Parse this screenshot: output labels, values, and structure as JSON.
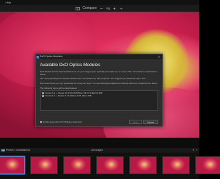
{
  "menubar": {
    "items": [
      "",
      "Help"
    ]
  },
  "toolbar": {
    "compare_label": "Compare",
    "zoom_value": "Fit"
  },
  "viewer": {
    "tag": ""
  },
  "dialog": {
    "window_title": "DxO Optics Modules",
    "heading": "Available DxO Optics Modules",
    "para1": "DxO PhotoLab has detected that some of your images were probably shot with one or more of the camera/lens combinations below.",
    "para2": "The corresponding DxO Optics Modules are not installed on this computer. We suggest you download them now.",
    "para3": "We recommend you only download the ones you need. You can download additional modules whenever needed in the future.",
    "list_label": "The following items will be downloaded:",
    "modules": [
      "Pentax K-1 + Pentax HD D FA 28-105mm F3.5-5.6 ED DC WR",
      "Pentax K-1 + Pentax D FA 100mm F2.8 Macro WR"
    ],
    "auto_label": "Enable automatic DxO Modules download",
    "download_label": "Next",
    "cancel_label": "Cancel"
  },
  "filmstrip": {
    "breadcrumb": "Photos > sunfloral2020",
    "count": "124 images",
    "thumb_count": 7
  },
  "colors": {
    "accent": "#3a8ee8",
    "dialog_bg": "#2e2e2e",
    "flower": "#e8345e"
  }
}
